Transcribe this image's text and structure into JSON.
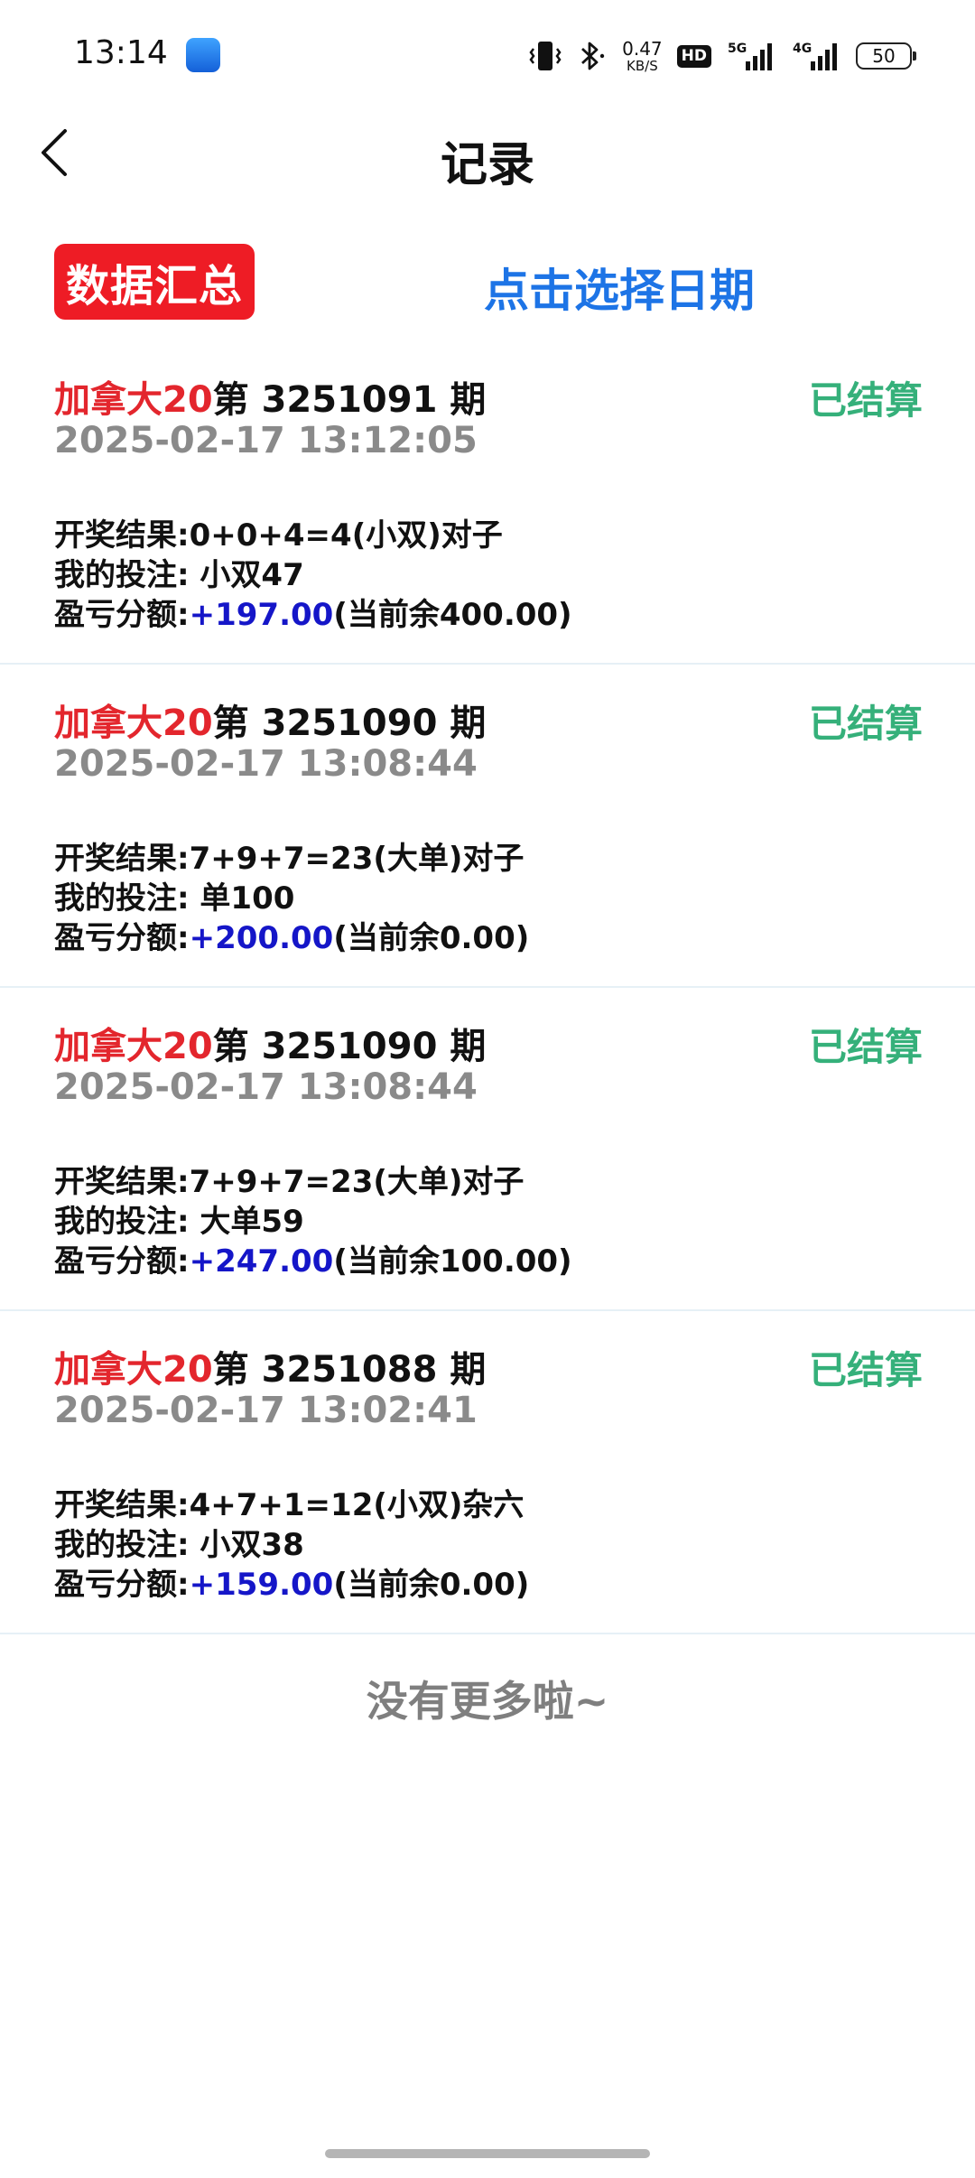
{
  "status_bar": {
    "time": "13:14",
    "net_speed_value": "0.47",
    "net_speed_unit": "KB/S",
    "hd_label": "HD",
    "battery_level": "50",
    "icons": [
      "app-notification-icon",
      "vibrate-icon",
      "bluetooth-icon",
      "hd-voice-icon",
      "signal-5g-icon",
      "signal-4g-icon",
      "battery-icon"
    ]
  },
  "nav": {
    "title": "记录"
  },
  "toolbar": {
    "summary_label": "数据汇总",
    "date_label": "点击选择日期"
  },
  "records": [
    {
      "lottery": "加拿大20",
      "period": "第 3251091 期",
      "status": "已结算",
      "time": "2025-02-17 13:12:05",
      "result": "开奖结果:0+0+4=4(小双)对子",
      "bet": "我的投注: 小双47",
      "pl_label": "盈亏分额:",
      "pl_amount": "+197.00",
      "balance": "(当前余400.00)"
    },
    {
      "lottery": "加拿大20",
      "period": "第 3251090 期",
      "status": "已结算",
      "time": "2025-02-17 13:08:44",
      "result": "开奖结果:7+9+7=23(大单)对子",
      "bet": "我的投注: 单100",
      "pl_label": "盈亏分额:",
      "pl_amount": "+200.00",
      "balance": "(当前余0.00)"
    },
    {
      "lottery": "加拿大20",
      "period": "第 3251090 期",
      "status": "已结算",
      "time": "2025-02-17 13:08:44",
      "result": "开奖结果:7+9+7=23(大单)对子",
      "bet": "我的投注: 大单59",
      "pl_label": "盈亏分额:",
      "pl_amount": "+247.00",
      "balance": "(当前余100.00)"
    },
    {
      "lottery": "加拿大20",
      "period": "第 3251088 期",
      "status": "已结算",
      "time": "2025-02-17 13:02:41",
      "result": "开奖结果:4+7+1=12(小双)杂六",
      "bet": "我的投注: 小双38",
      "pl_label": "盈亏分额:",
      "pl_amount": "+159.00",
      "balance": "(当前余0.00)"
    }
  ],
  "footer": {
    "no_more": "没有更多啦~"
  },
  "colors": {
    "summary_bg": "#ee1c25",
    "date_link": "#1d74e6",
    "lottery_name": "#e3262d",
    "status_settled": "#35b07a",
    "amount": "#1516c8",
    "time_gray": "#8a8a8a"
  }
}
